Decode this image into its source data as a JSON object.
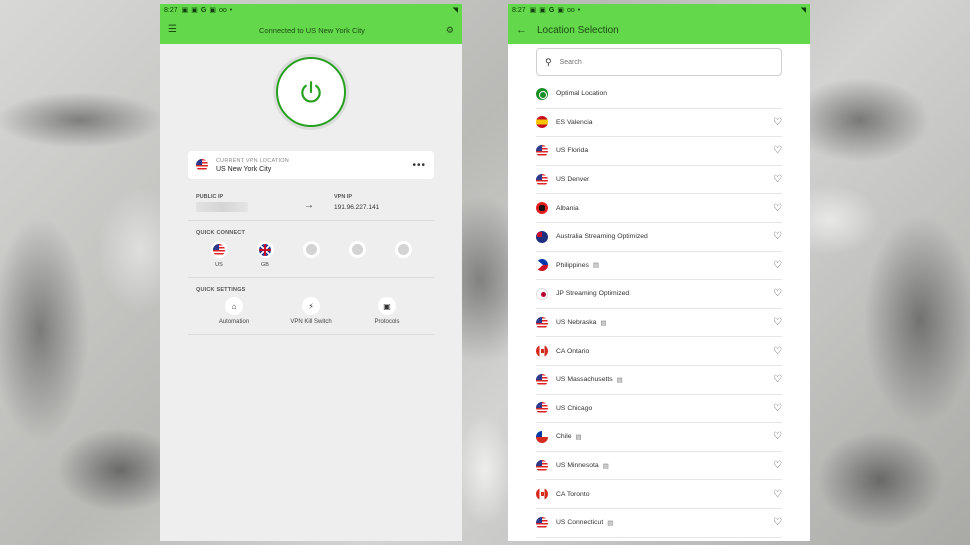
{
  "status_bar": {
    "time": "8:27",
    "icons": [
      "sim-icon",
      "nav-icon",
      "google-icon",
      "bookmark-icon",
      "voicemail-icon",
      "dot-icon"
    ],
    "right_icon": "wifi-icon"
  },
  "main_screen": {
    "title": "Connected to US New York City",
    "current_location_label": "CURRENT VPN LOCATION",
    "current_location": "US New York City",
    "public_ip_label": "PUBLIC IP",
    "vpn_ip_label": "VPN IP",
    "vpn_ip": "191.96.227.141",
    "quick_connect_label": "QUICK CONNECT",
    "quick_connect": [
      {
        "label": "US",
        "flag": "us"
      },
      {
        "label": "GB",
        "flag": "gb"
      },
      {
        "label": "",
        "flag": "empty"
      },
      {
        "label": "",
        "flag": "empty"
      },
      {
        "label": "",
        "flag": "empty"
      }
    ],
    "quick_settings_label": "QUICK SETTINGS",
    "quick_settings": [
      {
        "label": "Automation",
        "icon": "automation-icon"
      },
      {
        "label": "VPN Kill Switch",
        "icon": "kill-switch-icon"
      },
      {
        "label": "Protocols",
        "icon": "protocols-icon"
      }
    ],
    "accent_color": "#62d84a",
    "power_color": "#27a01e"
  },
  "location_screen": {
    "title": "Location Selection",
    "search_placeholder": "Search",
    "locations": [
      {
        "name": "Optimal Location",
        "flag": "opt",
        "favorite": false,
        "streaming": false
      },
      {
        "name": "ES Valencia",
        "flag": "es",
        "favorite": true,
        "streaming": false
      },
      {
        "name": "US Florida",
        "flag": "us",
        "favorite": true,
        "streaming": false
      },
      {
        "name": "US Denver",
        "flag": "us",
        "favorite": true,
        "streaming": false
      },
      {
        "name": "Albania",
        "flag": "al",
        "favorite": true,
        "streaming": false
      },
      {
        "name": "Australia Streaming Optimized",
        "flag": "au",
        "favorite": true,
        "streaming": false
      },
      {
        "name": "Philippines",
        "flag": "ph",
        "favorite": true,
        "streaming": true
      },
      {
        "name": "JP Streaming Optimized",
        "flag": "jp",
        "favorite": true,
        "streaming": false
      },
      {
        "name": "US Nebraska",
        "flag": "us",
        "favorite": true,
        "streaming": true
      },
      {
        "name": "CA Ontario",
        "flag": "ca",
        "favorite": true,
        "streaming": false
      },
      {
        "name": "US Massachusetts",
        "flag": "us",
        "favorite": true,
        "streaming": true
      },
      {
        "name": "US Chicago",
        "flag": "us",
        "favorite": true,
        "streaming": false
      },
      {
        "name": "Chile",
        "flag": "cl",
        "favorite": true,
        "streaming": true
      },
      {
        "name": "US Minnesota",
        "flag": "us",
        "favorite": true,
        "streaming": true
      },
      {
        "name": "CA Toronto",
        "flag": "ca",
        "favorite": true,
        "streaming": false
      },
      {
        "name": "US Connecticut",
        "flag": "us",
        "favorite": true,
        "streaming": true
      }
    ]
  }
}
